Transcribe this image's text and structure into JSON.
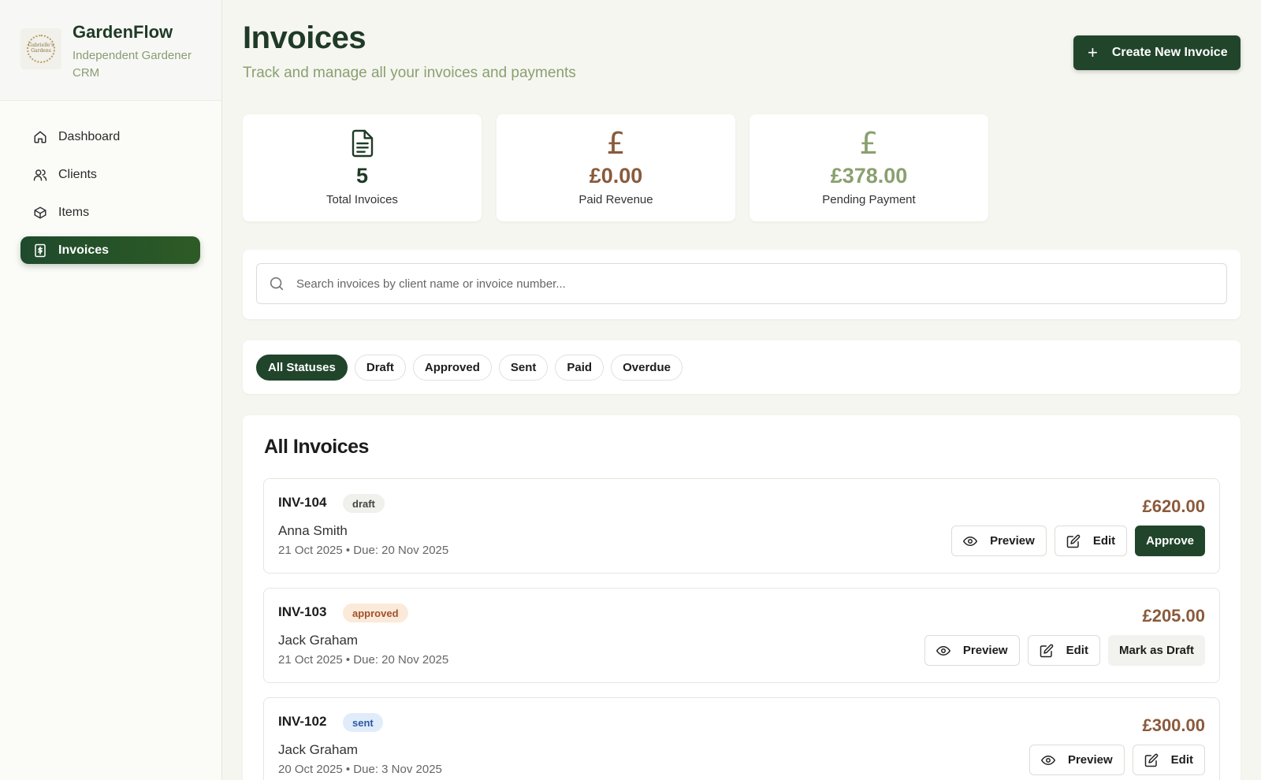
{
  "brand": {
    "name": "GardenFlow",
    "subtitle": "Independent Gardener CRM",
    "logo_text": "Gabrielle's Gardens"
  },
  "sidebar": {
    "items": [
      {
        "label": "Dashboard",
        "icon": "home-icon",
        "active": false
      },
      {
        "label": "Clients",
        "icon": "users-icon",
        "active": false
      },
      {
        "label": "Items",
        "icon": "box-icon",
        "active": false
      },
      {
        "label": "Invoices",
        "icon": "invoice-icon",
        "active": true
      }
    ]
  },
  "header": {
    "title": "Invoices",
    "subtitle": "Track and manage all your invoices and payments",
    "create_label": "Create New Invoice"
  },
  "stats": [
    {
      "value": "5",
      "label": "Total Invoices",
      "icon": "document-icon",
      "color": "#1f3a26"
    },
    {
      "value": "£0.00",
      "label": "Paid Revenue",
      "icon": "pound-icon",
      "color": "#8a5a3b"
    },
    {
      "value": "£378.00",
      "label": "Pending Payment",
      "icon": "pound-icon",
      "color": "#8aa06f"
    }
  ],
  "search": {
    "placeholder": "Search invoices by client name or invoice number...",
    "value": ""
  },
  "filters": {
    "options": [
      "All Statuses",
      "Draft",
      "Approved",
      "Sent",
      "Paid",
      "Overdue"
    ],
    "selected": "All Statuses"
  },
  "list": {
    "title": "All Invoices",
    "invoices": [
      {
        "number": "INV-104",
        "status": "draft",
        "client": "Anna Smith",
        "dates": "21 Oct 2025 • Due: 20 Nov 2025",
        "amount": "£620.00",
        "actions": [
          "Preview",
          "Edit",
          "Approve"
        ]
      },
      {
        "number": "INV-103",
        "status": "approved",
        "client": "Jack Graham",
        "dates": "21 Oct 2025 • Due: 20 Nov 2025",
        "amount": "£205.00",
        "actions": [
          "Preview",
          "Edit",
          "Mark as Draft"
        ]
      },
      {
        "number": "INV-102",
        "status": "sent",
        "client": "Jack Graham",
        "dates": "20 Oct 2025 • Due: 3 Nov 2025",
        "amount": "£300.00",
        "actions": [
          "Preview",
          "Edit"
        ]
      }
    ]
  },
  "colors": {
    "primary": "#21452b",
    "accent_green": "#8aa06f",
    "amount_brown": "#8a5a3b",
    "background": "#f6f6f1"
  }
}
